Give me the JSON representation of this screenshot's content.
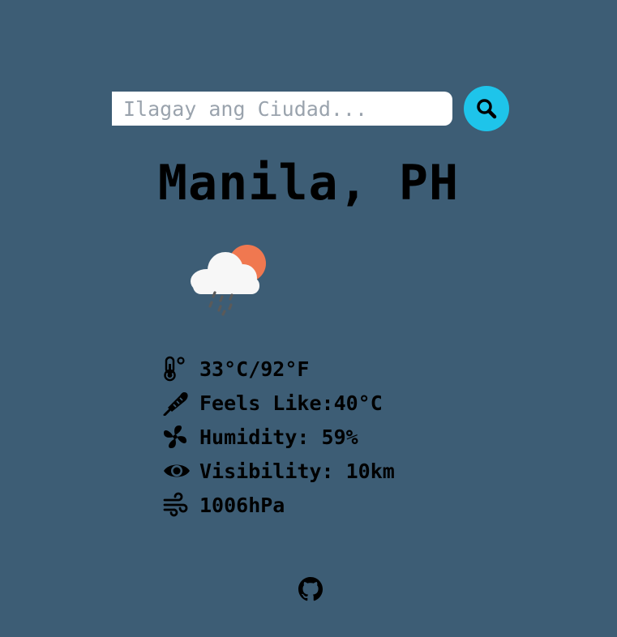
{
  "search": {
    "placeholder": "Ilagay ang Ciudad...",
    "value": ""
  },
  "location": {
    "title": "Manila, PH"
  },
  "weather": {
    "condition_icon": "cloud-sun-rain-icon"
  },
  "details": {
    "temperature": "33°C/92°F",
    "feels_like": "Feels Like:40°C",
    "humidity": "Humidity: 59%",
    "visibility": "Visibility: 10km",
    "pressure": "1006hPa"
  },
  "icons": {
    "search": "search-icon",
    "temperature": "thermometer-icon",
    "feels_like": "feather-thermometer-icon",
    "humidity": "fan-icon",
    "visibility": "eye-icon",
    "pressure": "wind-icon",
    "footer": "github-icon"
  },
  "colors": {
    "background": "#3d5d75",
    "search_button": "#1ec4ea",
    "sun": "#f07850",
    "text": "#000000"
  }
}
